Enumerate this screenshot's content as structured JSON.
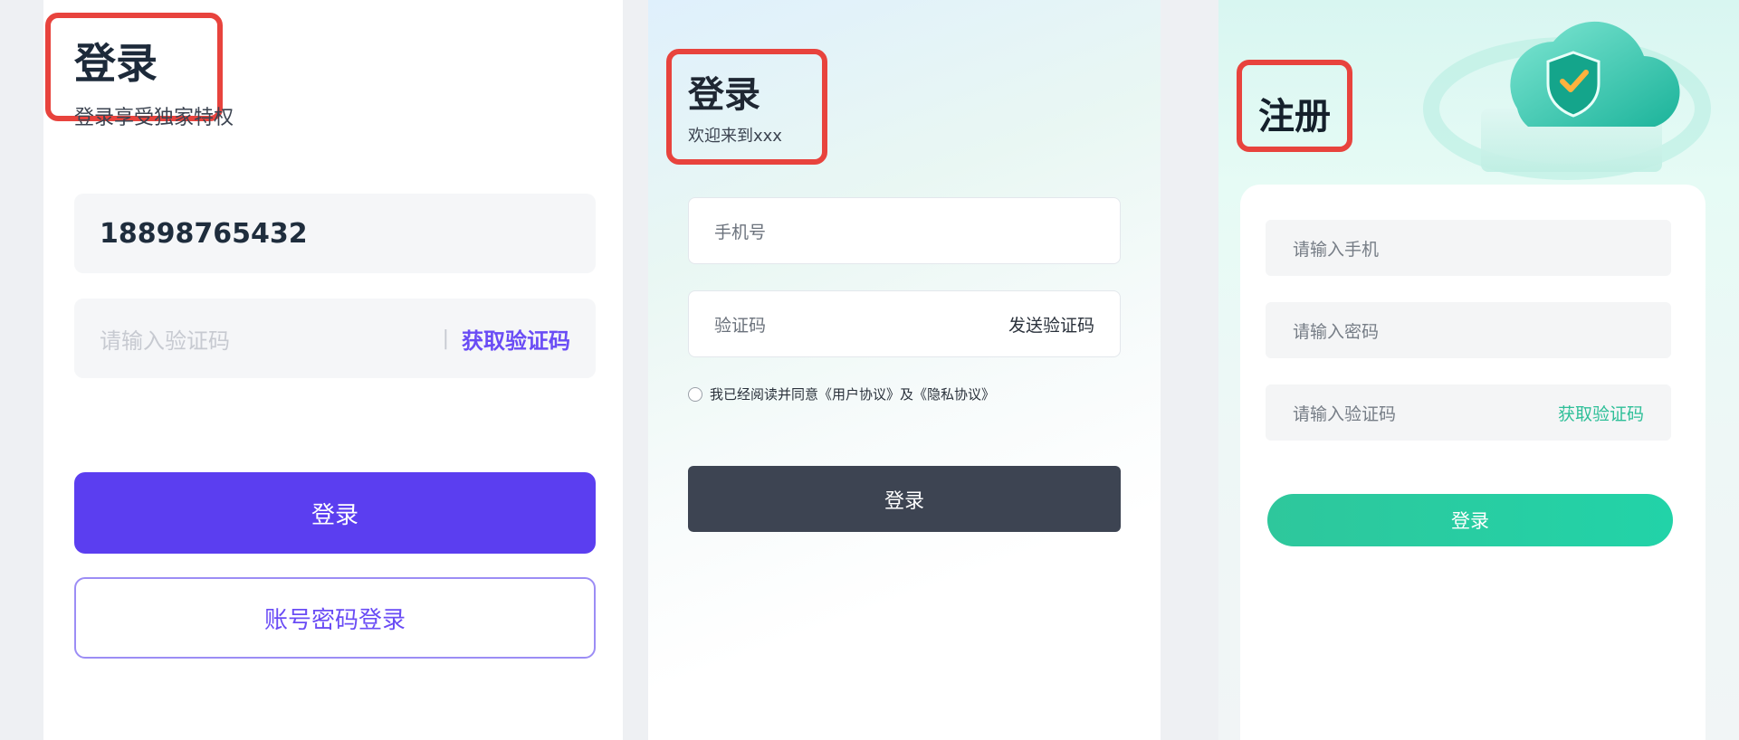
{
  "panel1": {
    "title": "登录",
    "subtitle": "登录享受独家特权",
    "phone_value": "18898765432",
    "code_placeholder": "请输入验证码",
    "divider": "|",
    "get_code": "获取验证码",
    "login_button": "登录",
    "account_login_button": "账号密码登录"
  },
  "panel2": {
    "title": "登录",
    "subtitle": "欢迎来到xxx",
    "mobile_placeholder": "手机号",
    "code_placeholder": "验证码",
    "send_code": "发送验证码",
    "agreement": "我已经阅读并同意《用户协议》及《隐私协议》",
    "login_button": "登录"
  },
  "panel3": {
    "title": "注册",
    "mobile_placeholder": "请输入手机",
    "password_placeholder": "请输入密码",
    "code_placeholder": "请输入验证码",
    "get_code": "获取验证码",
    "login_button": "登录",
    "illustration_icon": "cloud-shield-icon"
  },
  "colors": {
    "highlight_box": "#e8433d",
    "panel1_accent": "#5b3ef0",
    "panel2_button": "#3d4452",
    "panel3_accent": "#2ec79c"
  }
}
